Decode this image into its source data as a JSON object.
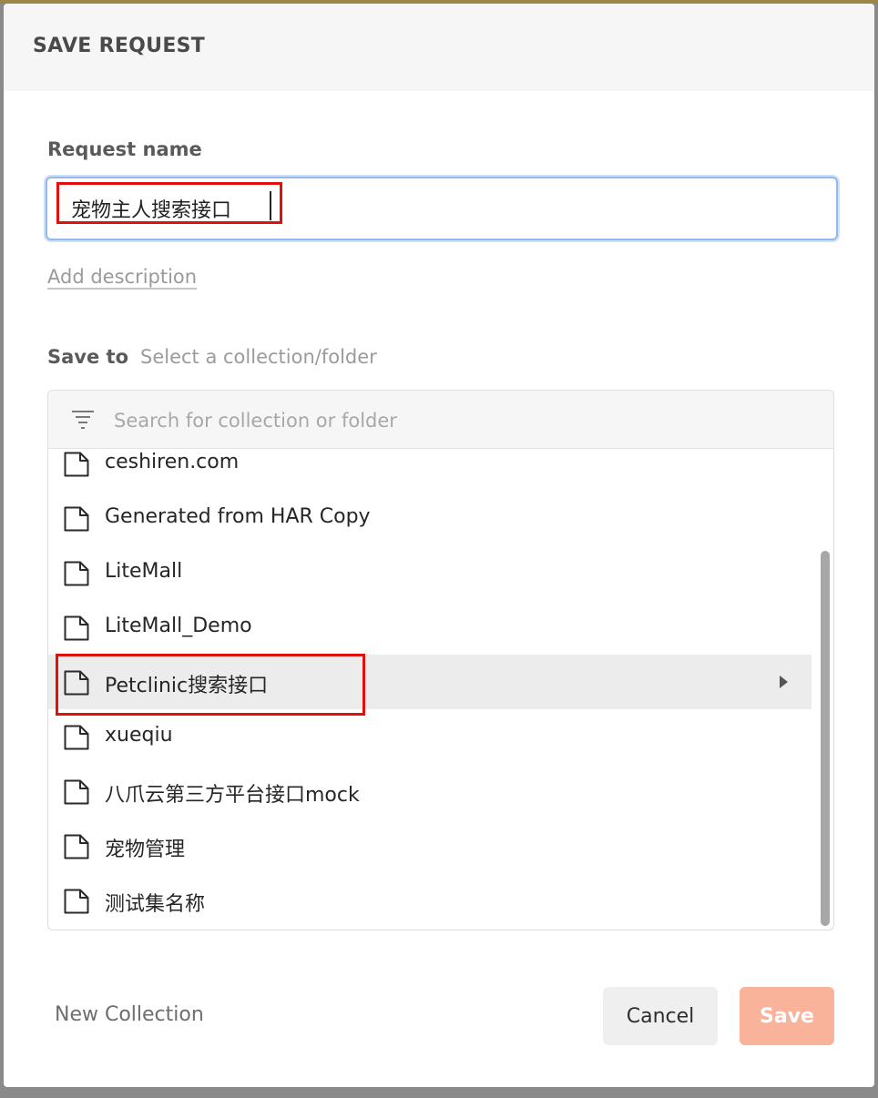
{
  "dialog": {
    "title": "SAVE REQUEST",
    "request_name_label": "Request name",
    "request_name_value": "宠物主人搜索接口",
    "add_description_label": "Add description",
    "save_to_label": "Save to",
    "save_to_hint": "Select a collection/folder",
    "search_placeholder": "Search for collection or folder",
    "collections": [
      {
        "label": "ceshiren.com",
        "icon": "folder-icon"
      },
      {
        "label": "Generated from HAR Copy",
        "icon": "folder-icon"
      },
      {
        "label": "LiteMall",
        "icon": "folder-icon"
      },
      {
        "label": "LiteMall_Demo",
        "icon": "folder-icon"
      },
      {
        "label": "Petclinic搜索接口",
        "icon": "folder-icon",
        "selected": true
      },
      {
        "label": "xueqiu",
        "icon": "folder-icon"
      },
      {
        "label": "八爪云第三方平台接口mock",
        "icon": "folder-icon"
      },
      {
        "label": "宠物管理",
        "icon": "folder-icon"
      },
      {
        "label": "测试集名称",
        "icon": "folder-icon"
      }
    ],
    "new_collection_label": "New Collection",
    "cancel_label": "Cancel",
    "save_label": "Save"
  },
  "colors": {
    "accent": "#93b9ec",
    "save_button": "#f9b39a",
    "highlight_box": "#e30f0f",
    "selected_row": "#ececec"
  }
}
